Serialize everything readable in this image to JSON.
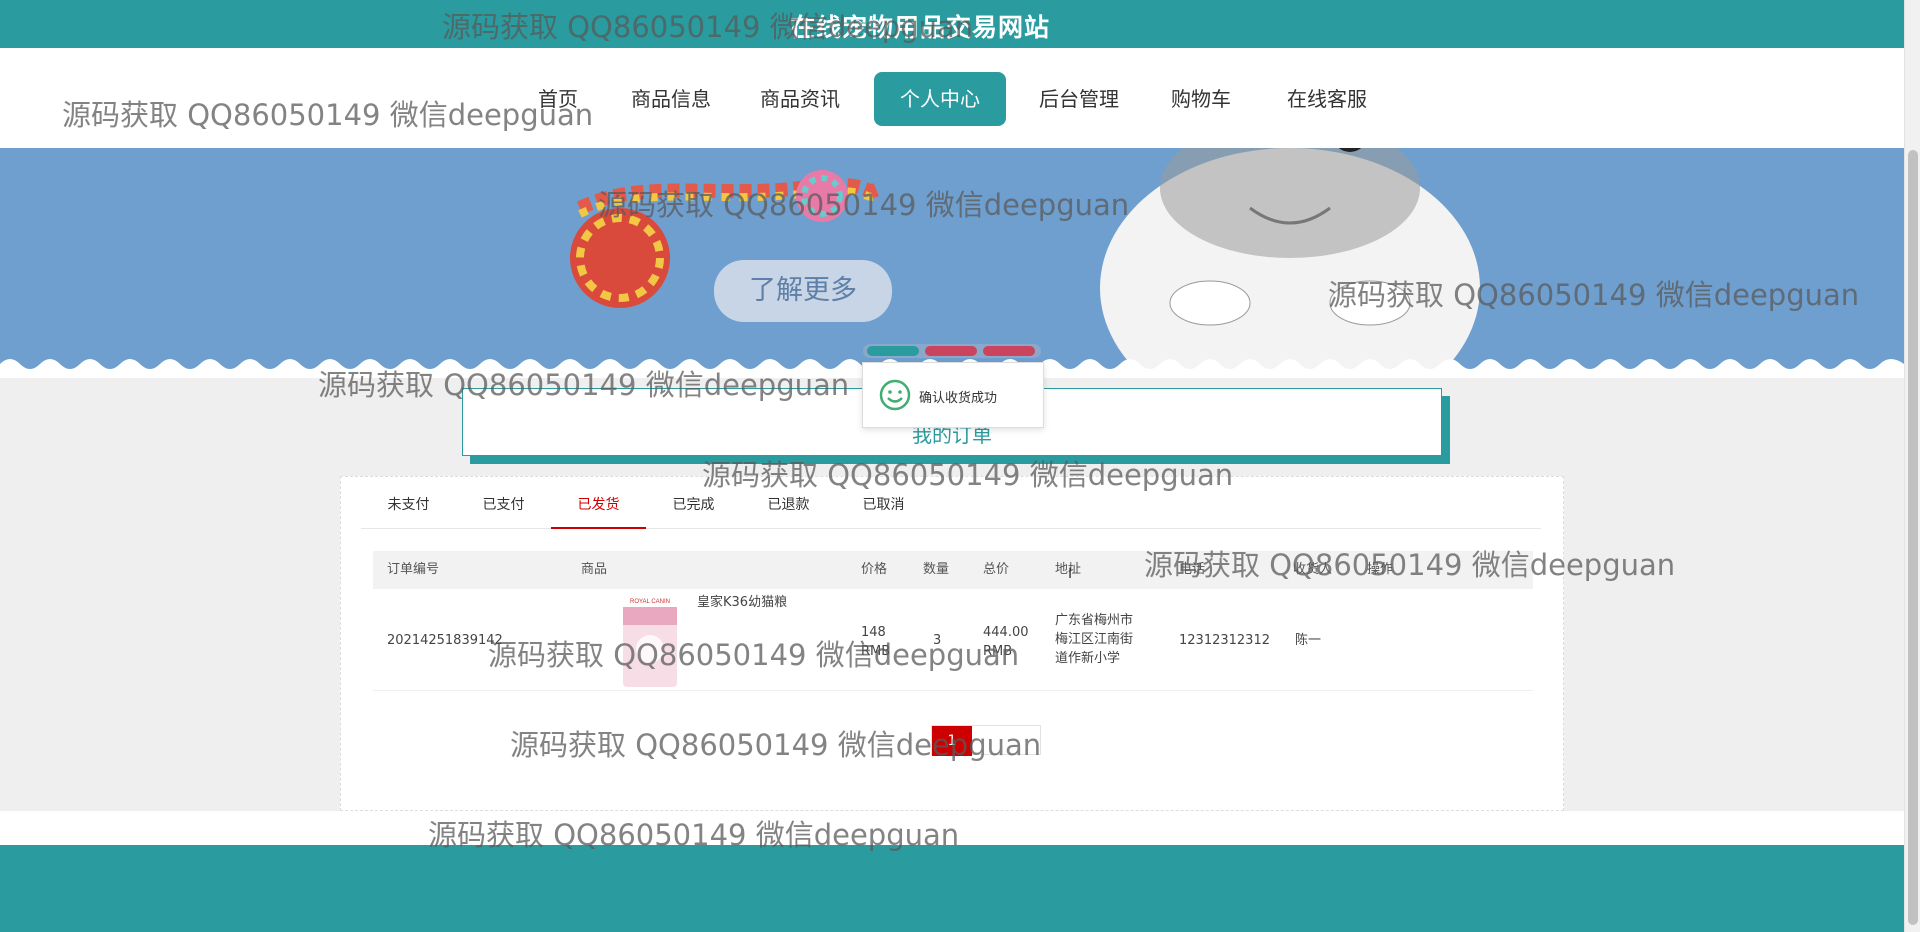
{
  "site_title": "在线宠物用品交易网站",
  "nav": [
    {
      "label": "首页",
      "active": false
    },
    {
      "label": "商品信息",
      "active": false
    },
    {
      "label": "商品资讯",
      "active": false
    },
    {
      "label": "个人中心",
      "active": true
    },
    {
      "label": "后台管理",
      "active": false
    },
    {
      "label": "购物车",
      "active": false
    },
    {
      "label": "在线客服",
      "active": false
    }
  ],
  "banner": {
    "learn_more": "了解更多"
  },
  "toast": {
    "message": "确认收货成功"
  },
  "section_title": "我的订单",
  "tabs": [
    "未支付",
    "已支付",
    "已发货",
    "已完成",
    "已退款",
    "已取消"
  ],
  "active_tab": "已发货",
  "table": {
    "headers": [
      "订单编号",
      "商品",
      "价格",
      "数量",
      "总价",
      "地址",
      "电话",
      "收货人",
      "操作"
    ],
    "rows": [
      {
        "order_no": "20214251839142",
        "product_brand": "ROYAL CANIN",
        "product_name": "皇家K36幼猫粮",
        "price": "148",
        "price_unit": "RMB",
        "quantity": "3",
        "total": "444.00",
        "total_unit": "RMB",
        "address": "广东省梅州市梅江区江南街道作新小学",
        "phone": "12312312312",
        "receiver": "陈一"
      }
    ]
  },
  "pagination": {
    "current": "1"
  },
  "watermark": "源码获取 QQ86050149 微信deepguan",
  "colors": {
    "primary": "#2a9b9e",
    "banner": "#6f9fcf",
    "active_tab": "#cc0000",
    "pager_active": "#cc0000"
  }
}
